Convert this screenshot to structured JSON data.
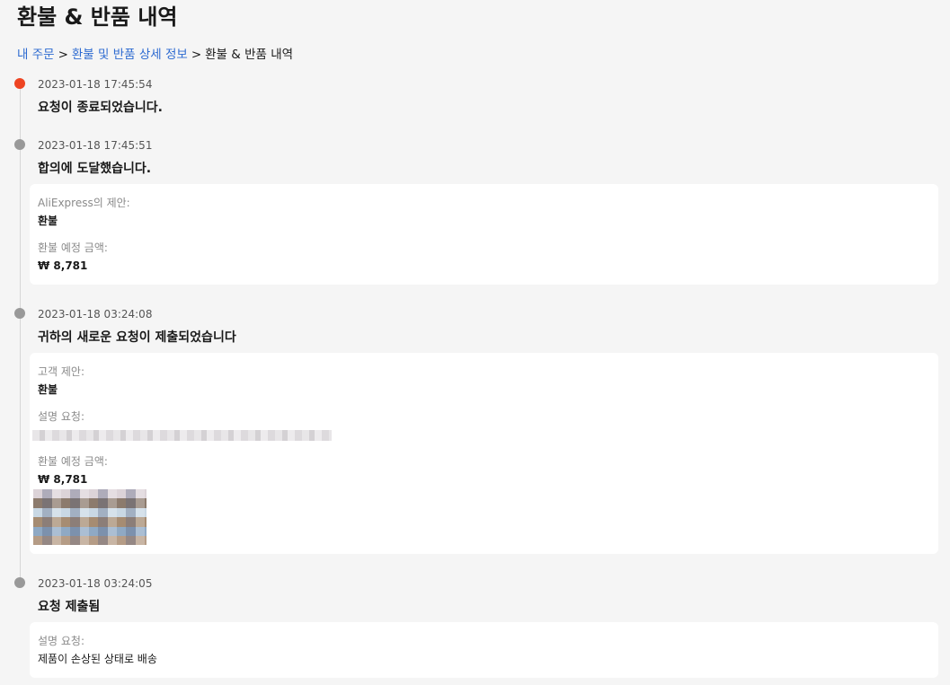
{
  "page": {
    "title": "환불 & 반품 내역"
  },
  "breadcrumb": {
    "items": [
      "내 주문",
      "환불 및 반품 상세 정보"
    ],
    "separator": ">",
    "current": "환불 & 반품 내역"
  },
  "colors": {
    "link": "#2e6bd1",
    "active_dot": "#ee4422",
    "inactive_dot": "#999999",
    "timeline_line": "#d6d6d6"
  },
  "timeline": [
    {
      "timestamp": "2023-01-18 17:45:54",
      "title": "요청이 종료되었습니다.",
      "active": true
    },
    {
      "timestamp": "2023-01-18 17:45:51",
      "title": "합의에 도달했습니다.",
      "details": {
        "proposal_label": "AliExpress의 제안:",
        "proposal_value": "환불",
        "amount_label": "환불 예정 금액:",
        "amount_value": "₩ 8,781"
      }
    },
    {
      "timestamp": "2023-01-18 03:24:08",
      "title": "귀하의 새로운 요청이 제출되었습니다",
      "details": {
        "proposal_label": "고객 제안:",
        "proposal_value": "환불",
        "description_label": "설명 요청:",
        "amount_label": "환불 예정 금액:",
        "amount_value": "₩ 8,781"
      }
    },
    {
      "timestamp": "2023-01-18 03:24:05",
      "title": "요청 제출됨",
      "details": {
        "description_label": "설명 요청:",
        "description_value": "제품이 손상된 상태로 배송"
      }
    }
  ]
}
